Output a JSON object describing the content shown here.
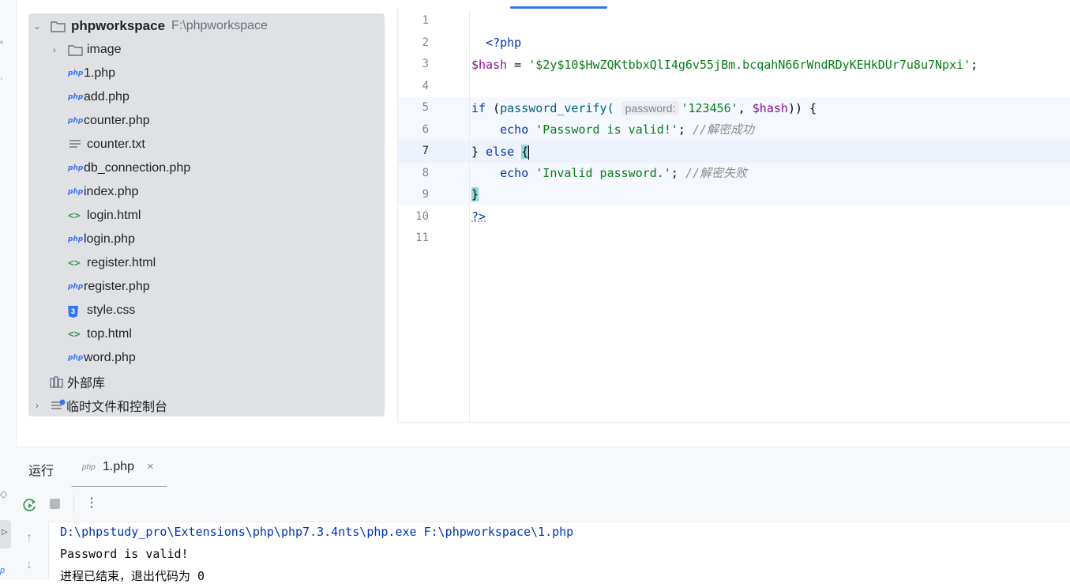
{
  "project_tree": {
    "root": {
      "name": "phpworkspace",
      "path": "F:\\phpworkspace"
    },
    "items": [
      {
        "type": "folder",
        "label": "image",
        "icon": "folder-icon"
      },
      {
        "type": "php",
        "label": "1.php",
        "icon": "php-file-icon"
      },
      {
        "type": "php",
        "label": "add.php",
        "icon": "php-file-icon"
      },
      {
        "type": "php",
        "label": "counter.php",
        "icon": "php-file-icon"
      },
      {
        "type": "txt",
        "label": "counter.txt",
        "icon": "text-file-icon"
      },
      {
        "type": "php",
        "label": "db_connection.php",
        "icon": "php-file-icon"
      },
      {
        "type": "php",
        "label": "index.php",
        "icon": "php-file-icon"
      },
      {
        "type": "html",
        "label": "login.html",
        "icon": "html-file-icon"
      },
      {
        "type": "php",
        "label": "login.php",
        "icon": "php-file-icon"
      },
      {
        "type": "html",
        "label": "register.html",
        "icon": "html-file-icon"
      },
      {
        "type": "php",
        "label": "register.php",
        "icon": "php-file-icon"
      },
      {
        "type": "css",
        "label": "style.css",
        "icon": "css-file-icon"
      },
      {
        "type": "html",
        "label": "top.html",
        "icon": "html-file-icon"
      },
      {
        "type": "php",
        "label": "word.php",
        "icon": "php-file-icon"
      }
    ],
    "external_libraries": "外部库",
    "scratches": "临时文件和控制台"
  },
  "editor": {
    "line_numbers": [
      "1",
      "2",
      "3",
      "4",
      "5",
      "6",
      "7",
      "8",
      "9",
      "10",
      "11"
    ],
    "current_line": "7",
    "code": {
      "l1_open": "<?php",
      "l3_var": "$hash",
      "l3_eq": " = ",
      "l3_str": "'$2y$10$HwZQKtbbxQlI4g6v55jBm.bcqahN66rWndRDyKEHkDUr7u8u7Npxi'",
      "l3_semi": ";",
      "l5_if": "if",
      "l5_open": " (",
      "l5_fn": "password_verify(",
      "l5_hint": "password:",
      "l5_arg": "'123456'",
      "l5_comma": ", ",
      "l5_var": "$hash",
      "l5_close": ")) {",
      "l6_echo": "echo",
      "l6_str": "'Password is valid!'",
      "l6_semi": "; ",
      "l6_cmt": "//解密成功",
      "l7_close": "} ",
      "l7_else": "else",
      "l7_open": "{",
      "l8_echo": "echo",
      "l8_str": "'Invalid password.'",
      "l8_semi": "; ",
      "l8_cmt": "//解密失败",
      "l9_close": "}",
      "l10_end": "?>"
    }
  },
  "run_panel": {
    "title": "运行",
    "tab_label": "1.php",
    "lines": [
      "D:\\phpstudy_pro\\Extensions\\php\\php7.3.4nts\\php.exe F:\\phpworkspace\\1.php",
      "Password is valid!",
      "进程已结束，退出代码为 0"
    ]
  },
  "colors": {
    "accent": "#3574f0",
    "keyword": "#0033b3",
    "variable": "#871094",
    "string": "#067d17",
    "comment": "#8c8c8c",
    "html_icon": "#3d9b5f"
  }
}
